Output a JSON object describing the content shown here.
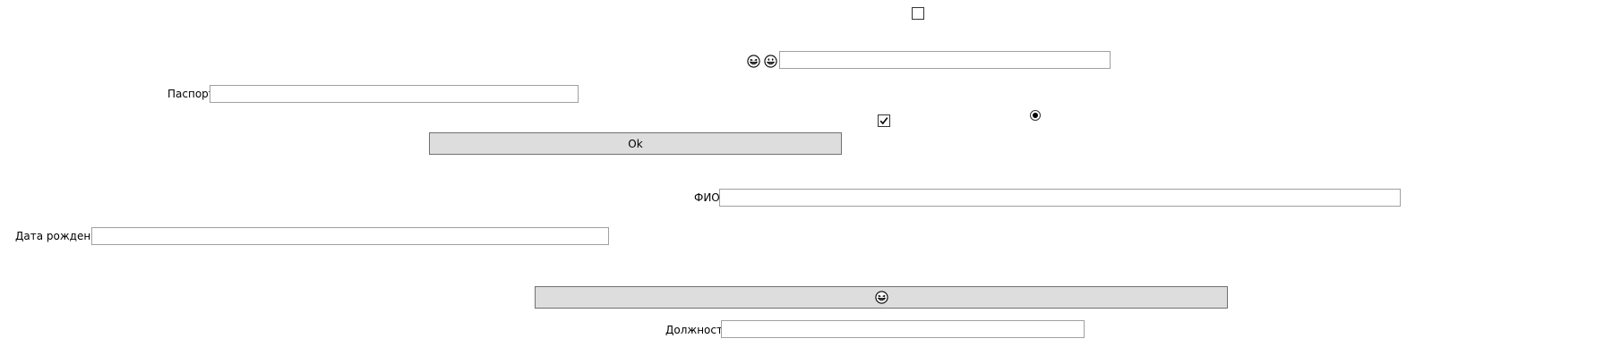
{
  "top_checkbox": {
    "checked": false
  },
  "emoji_row": {
    "icons": [
      "grinning-squint-face",
      "grinning-face"
    ],
    "input_value": "",
    "input_placeholder": ""
  },
  "passport": {
    "label": "Паспорт",
    "value": "",
    "placeholder": ""
  },
  "middle_checkbox": {
    "checked": true
  },
  "radio": {
    "selected": true
  },
  "ok_button": {
    "label": "Ok"
  },
  "fio": {
    "label": "ФИО",
    "value": "",
    "placeholder": ""
  },
  "birth_date": {
    "label": "Дата рождения",
    "value": "",
    "placeholder": ""
  },
  "emoji_button": {
    "icon": "grinning-squint-face"
  },
  "position": {
    "label": "Должность",
    "value": "",
    "placeholder": ""
  }
}
